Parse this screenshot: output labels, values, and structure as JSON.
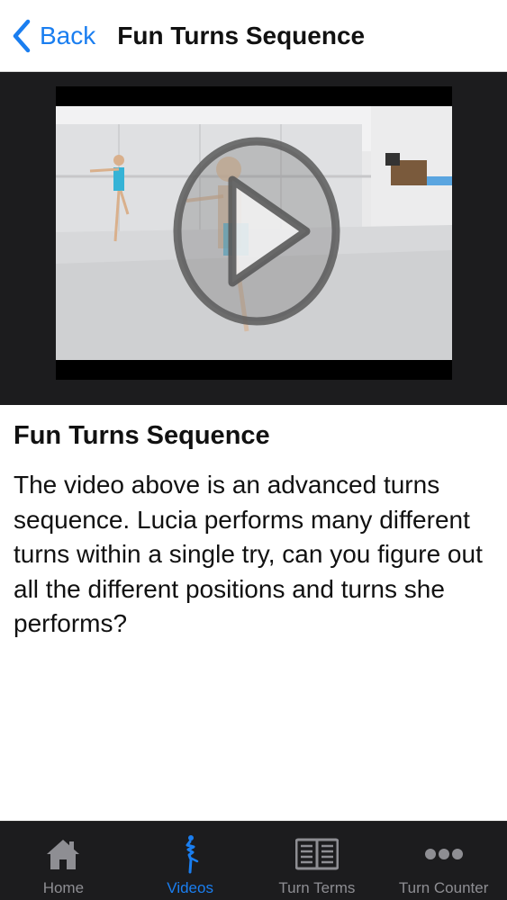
{
  "navbar": {
    "back_label": "Back",
    "title": "Fun Turns Sequence"
  },
  "video": {
    "play_icon": "play-icon"
  },
  "content": {
    "title": "Fun Turns Sequence",
    "body": "The video above is an advanced turns sequence. Lucia performs many different turns within a single try, can you figure out all the different positions and turns she performs?"
  },
  "tabbar": {
    "items": [
      {
        "label": "Home",
        "icon": "home-icon"
      },
      {
        "label": "Videos",
        "icon": "dancer-icon",
        "active": true
      },
      {
        "label": "Turn Terms",
        "icon": "book-icon"
      },
      {
        "label": "Turn Counter",
        "icon": "more-icon"
      }
    ]
  },
  "colors": {
    "accent": "#1a7ef0",
    "bar_background": "#1c1c1e",
    "inactive_tab": "#8e8e93"
  }
}
